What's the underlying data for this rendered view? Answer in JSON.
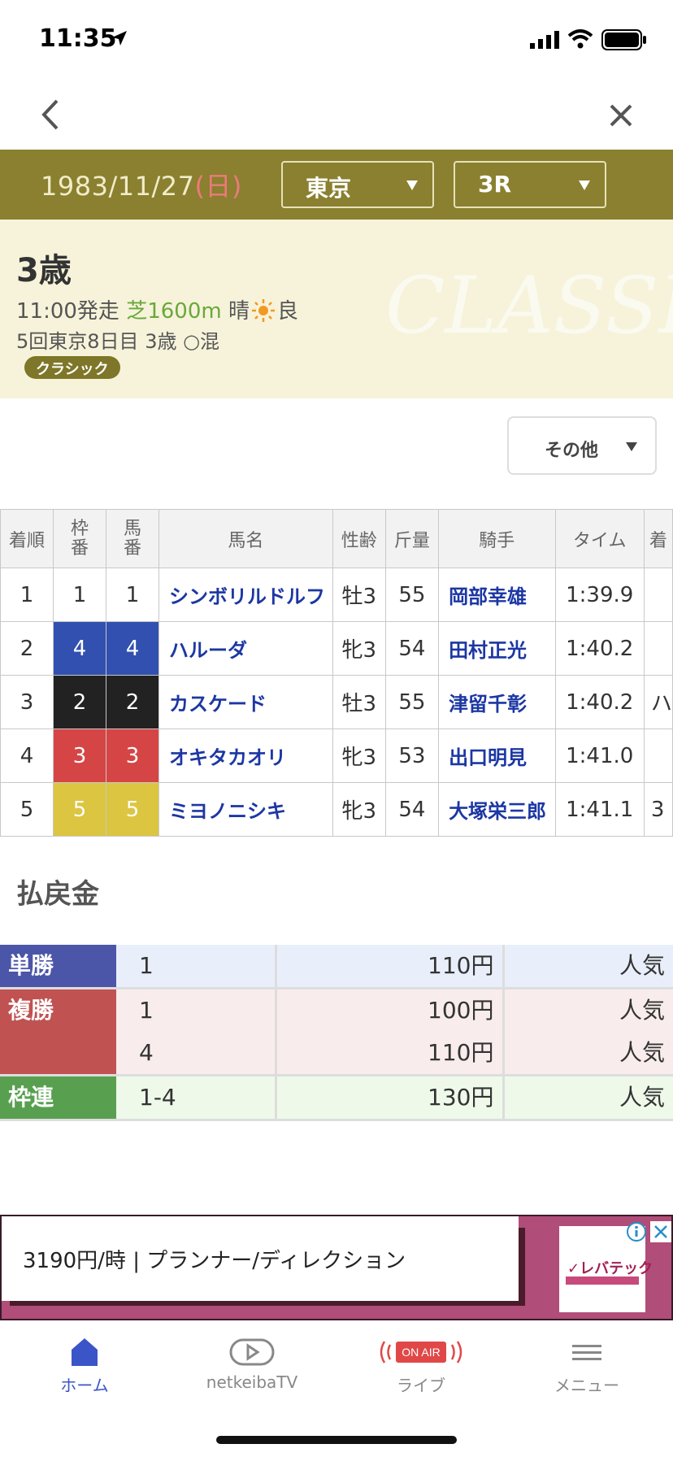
{
  "status": {
    "time": "11:35"
  },
  "header": {
    "date": "1983/11/27",
    "dow": "(日)",
    "venue": "東京",
    "race": "3R"
  },
  "race": {
    "title": "3歳",
    "time": "11:00発走",
    "course": "芝1600m",
    "weather": "晴",
    "going": "良",
    "meeting": "5回東京8日目",
    "cond": "3歳 ○混",
    "grade_badge": "クラシック",
    "watermark": "CLASSIC"
  },
  "filter": {
    "label": "その他"
  },
  "results": {
    "headers": {
      "rank": "着順",
      "frame_top": "枠",
      "frame_bottom": "番",
      "num_top": "馬",
      "num_bottom": "番",
      "name": "馬名",
      "sexage": "性齢",
      "weight": "斤量",
      "jockey": "騎手",
      "time": "タイム",
      "extra": "着"
    },
    "rows": [
      {
        "rank": "1",
        "frame": "1",
        "num": "1",
        "name": "シンボリルドルフ",
        "sexage": "牡3",
        "weight": "55",
        "jockey": "岡部幸雄",
        "time": "1:39.9",
        "extra": ""
      },
      {
        "rank": "2",
        "frame": "4",
        "num": "4",
        "name": "ハルーダ",
        "sexage": "牝3",
        "weight": "54",
        "jockey": "田村正光",
        "time": "1:40.2",
        "extra": ""
      },
      {
        "rank": "3",
        "frame": "2",
        "num": "2",
        "name": "カスケード",
        "sexage": "牡3",
        "weight": "55",
        "jockey": "津留千彰",
        "time": "1:40.2",
        "extra": "ハ"
      },
      {
        "rank": "4",
        "frame": "3",
        "num": "3",
        "name": "オキタカオリ",
        "sexage": "牝3",
        "weight": "53",
        "jockey": "出口明見",
        "time": "1:41.0",
        "extra": ""
      },
      {
        "rank": "5",
        "frame": "5",
        "num": "5",
        "name": "ミヨノニシキ",
        "sexage": "牝3",
        "weight": "54",
        "jockey": "大塚栄三郎",
        "time": "1:41.1",
        "extra": "3"
      }
    ],
    "frame_colors": {
      "1": "#ffffff",
      "2": "#222222",
      "3": "#d64545",
      "4": "#3150b0",
      "5": "#dcc540"
    }
  },
  "payout": {
    "heading": "払戻金",
    "rows": [
      {
        "type": "単勝",
        "color": "#4b56a8",
        "bg": "#e9effa",
        "combos": [
          "1"
        ],
        "amounts": [
          "110円"
        ],
        "pops": [
          "人気"
        ]
      },
      {
        "type": "複勝",
        "color": "#c05252",
        "bg": "#f9ecec",
        "combos": [
          "1",
          "4"
        ],
        "amounts": [
          "100円",
          "110円"
        ],
        "pops": [
          "人気",
          "人気"
        ]
      },
      {
        "type": "枠連",
        "color": "#58a050",
        "bg": "#eef9ea",
        "combos": [
          "1-4"
        ],
        "amounts": [
          "130円"
        ],
        "pops": [
          "人気"
        ]
      }
    ]
  },
  "ad": {
    "text": "3190円/時 | プランナー/ディレクション",
    "logo_text": "✓レバテック",
    "info_icon": "info-icon",
    "close_icon": "close-icon"
  },
  "tabs": [
    {
      "label": "ホーム",
      "icon": "home-icon",
      "active": true
    },
    {
      "label": "netkeibaTV",
      "icon": "tv-icon",
      "active": false
    },
    {
      "label": "ライブ",
      "icon": "onair-icon",
      "badge": "ON AIR",
      "active": false
    },
    {
      "label": "メニュー",
      "icon": "menu-icon",
      "active": false
    }
  ]
}
